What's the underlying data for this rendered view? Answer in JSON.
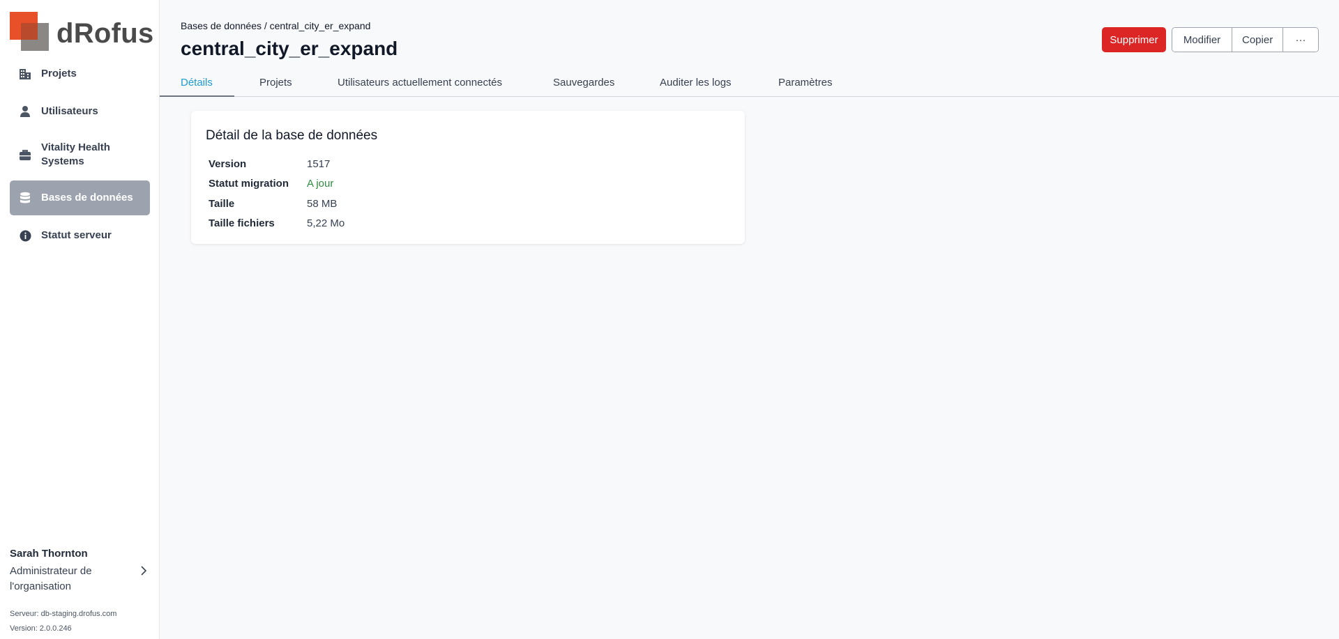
{
  "brand": {
    "name": "dRofus",
    "colors": {
      "orange": "#e8502a",
      "gray": "#8a8785"
    }
  },
  "sidebar": {
    "items": [
      {
        "label": "Projets",
        "icon": "building-icon"
      },
      {
        "label": "Utilisateurs",
        "icon": "user-icon"
      },
      {
        "label": "Vitality Health Systems",
        "icon": "briefcase-icon"
      },
      {
        "label": "Bases de données",
        "icon": "database-icon",
        "active": true
      },
      {
        "label": "Statut serveur",
        "icon": "info-icon"
      }
    ],
    "user": {
      "name": "Sarah Thornton",
      "role": "Administrateur de l'organisation",
      "server": "Serveur: db-staging.drofus.com",
      "version": "Version: 2.0.0.246"
    }
  },
  "header": {
    "breadcrumb": "Bases de données / central_city_er_expand",
    "title": "central_city_er_expand"
  },
  "actions": {
    "delete": "Supprimer",
    "modify": "Modifier",
    "copy": "Copier",
    "more": "···",
    "danger_color": "#dc2626"
  },
  "tabs": [
    {
      "label": "Détails",
      "active": true
    },
    {
      "label": "Projets"
    },
    {
      "label": "Utilisateurs actuellement connectés"
    },
    {
      "label": "Sauvegardes"
    },
    {
      "label": "Auditer les logs"
    },
    {
      "label": "Paramètres"
    }
  ],
  "details": {
    "title": "Détail de la base de données",
    "rows": [
      {
        "key": "Version",
        "value": "1517"
      },
      {
        "key": "Statut migration",
        "value": "A jour",
        "status_color": "#2e8b3e"
      },
      {
        "key": "Taille",
        "value": "58 MB"
      },
      {
        "key": "Taille fichiers",
        "value": "5,22 Mo"
      }
    ]
  }
}
